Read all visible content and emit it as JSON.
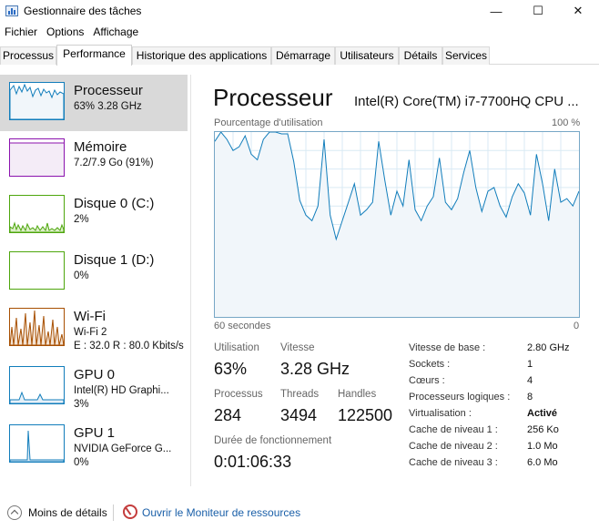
{
  "window": {
    "title": "Gestionnaire des tâches",
    "minimize_glyph": "—",
    "maximize_glyph": "☐",
    "close_glyph": "✕"
  },
  "menu": [
    "Fichier",
    "Options",
    "Affichage"
  ],
  "tabs": [
    {
      "label": "Processus"
    },
    {
      "label": "Performance",
      "active": true
    },
    {
      "label": "Historique des applications"
    },
    {
      "label": "Démarrage"
    },
    {
      "label": "Utilisateurs"
    },
    {
      "label": "Détails"
    },
    {
      "label": "Services"
    }
  ],
  "sidebar": {
    "items": [
      {
        "title": "Processeur",
        "sub1": "63% 3.28 GHz",
        "sub2": ""
      },
      {
        "title": "Mémoire",
        "sub1": "7.2/7.9 Go (91%)",
        "sub2": ""
      },
      {
        "title": "Disque 0 (C:)",
        "sub1": "2%",
        "sub2": ""
      },
      {
        "title": "Disque 1 (D:)",
        "sub1": "0%",
        "sub2": ""
      },
      {
        "title": "Wi-Fi",
        "sub1": "Wi-Fi 2",
        "sub2": "E : 32.0  R : 80.0 Kbits/s"
      },
      {
        "title": "GPU 0",
        "sub1": "Intel(R) HD Graphi...",
        "sub2": "3%"
      },
      {
        "title": "GPU 1",
        "sub1": "NVIDIA GeForce G...",
        "sub2": "0%"
      }
    ]
  },
  "main": {
    "title": "Processeur",
    "cpu_name": "Intel(R) Core(TM) i7-7700HQ CPU ...",
    "graph": {
      "y_label": "Pourcentage d'utilisation",
      "y_max_label": "100 %",
      "x_left_label": "60 secondes",
      "x_right_label": "0",
      "usage_percent": [
        95,
        100,
        96,
        90,
        92,
        98,
        88,
        85,
        96,
        100,
        100,
        99,
        99,
        84,
        63,
        55,
        52,
        60,
        96,
        55,
        42,
        52,
        62,
        72,
        55,
        58,
        62,
        95,
        74,
        55,
        68,
        60,
        85,
        58,
        52,
        60,
        65,
        86,
        62,
        58,
        64,
        78,
        90,
        70,
        57,
        68,
        70,
        60,
        54,
        65,
        72,
        67,
        55,
        88,
        72,
        52,
        80,
        62,
        64,
        60,
        68
      ]
    },
    "stats": {
      "utilisation_label": "Utilisation",
      "utilisation_value": "63%",
      "vitesse_label": "Vitesse",
      "vitesse_value": "3.28 GHz",
      "processus_label": "Processus",
      "processus_value": "284",
      "threads_label": "Threads",
      "threads_value": "3494",
      "handles_label": "Handles",
      "handles_value": "122500",
      "uptime_label": "Durée de fonctionnement",
      "uptime_value": "0:01:06:33"
    },
    "details": [
      {
        "key": "Vitesse de base :",
        "value": "2.80 GHz"
      },
      {
        "key": "Sockets :",
        "value": "1"
      },
      {
        "key": "Cœurs :",
        "value": "4"
      },
      {
        "key": "Processeurs logiques :",
        "value": "8"
      },
      {
        "key": "Virtualisation :",
        "value": "Activé"
      },
      {
        "key": "Cache de niveau 1 :",
        "value": "256 Ko"
      },
      {
        "key": "Cache de niveau 2 :",
        "value": "1.0 Mo"
      },
      {
        "key": "Cache de niveau 3 :",
        "value": "6.0 Mo"
      }
    ]
  },
  "footer": {
    "less_details": "Moins de détails",
    "resource_monitor": "Ouvrir le Moniteur de ressources"
  },
  "colors": {
    "cpu": "#117dbb",
    "memory": "#8b12ae",
    "disk": "#4da60c",
    "wifi": "#a74f01",
    "gpu": "#117dbb",
    "link": "#1a5fa8"
  }
}
